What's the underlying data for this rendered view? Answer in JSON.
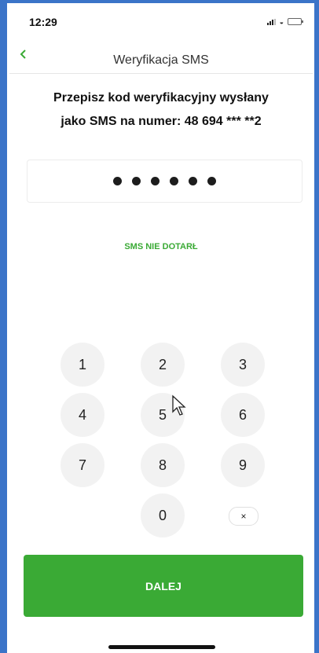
{
  "status_bar": {
    "time": "12:29"
  },
  "nav": {
    "back_icon": "chevron-left-icon",
    "title": "Weryfikacja SMS"
  },
  "instruction": {
    "line1": "Przepisz kod weryfikacyjny wysłany",
    "line2": "jako SMS na numer: 48 694 *** **2"
  },
  "code_input": {
    "filled_digits": 6,
    "max_digits": 6
  },
  "sms_not_received": "SMS NIE DOTARŁ",
  "keypad": {
    "keys": [
      "1",
      "2",
      "3",
      "4",
      "5",
      "6",
      "7",
      "8",
      "9",
      "0"
    ],
    "delete_label": "×"
  },
  "next_button": "DALEJ",
  "colors": {
    "accent": "#3aaa35",
    "frame": "#3b74c8"
  }
}
